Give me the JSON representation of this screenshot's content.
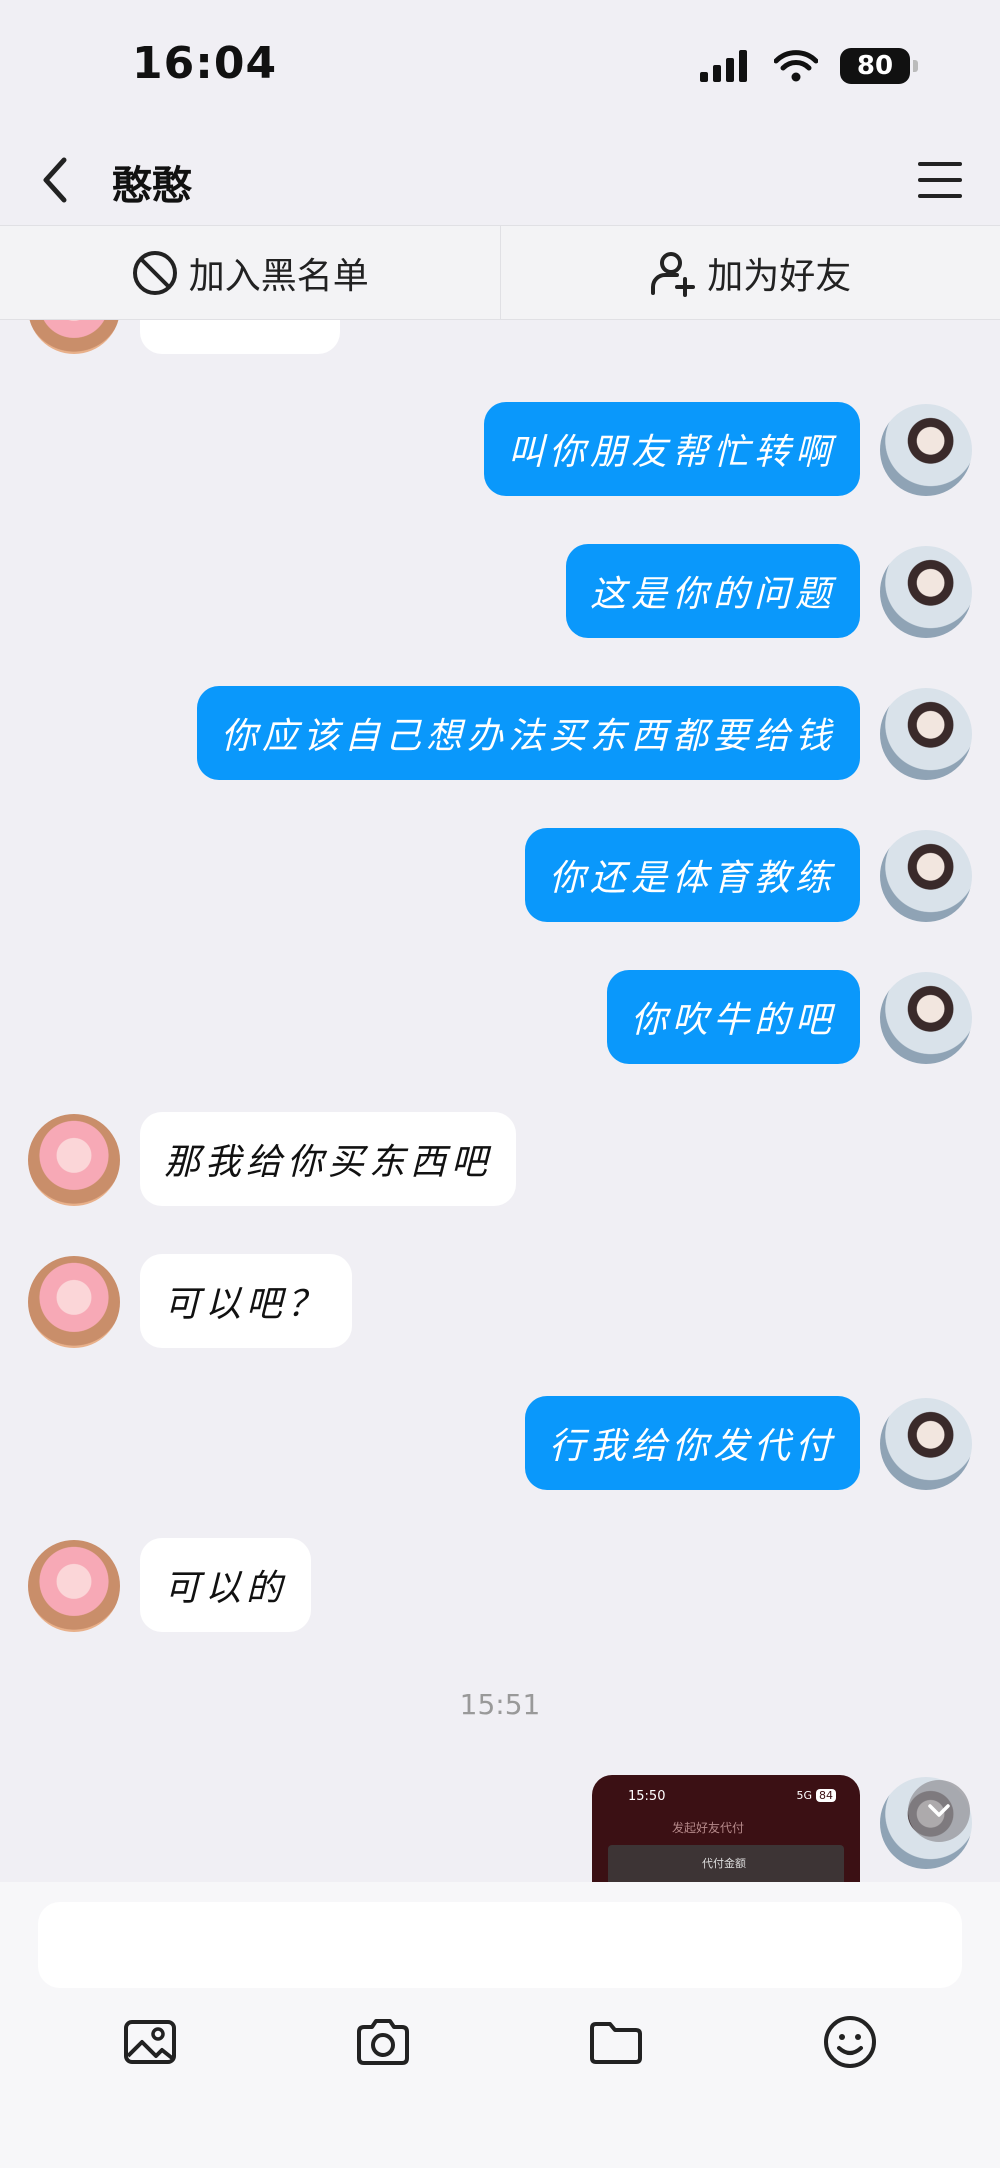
{
  "status": {
    "time": "16:04",
    "battery": "80"
  },
  "nav": {
    "title": "憨憨"
  },
  "actions": {
    "blacklist": "加入黑名单",
    "add_friend": "加为好友"
  },
  "messages": [
    {
      "from": "me",
      "text": "叫你朋友帮忙转啊"
    },
    {
      "from": "me",
      "text": "这是你的问题"
    },
    {
      "from": "me",
      "text": "你应该自己想办法买东西都要给钱"
    },
    {
      "from": "me",
      "text": "你还是体育教练"
    },
    {
      "from": "me",
      "text": "你吹牛的吧"
    },
    {
      "from": "them",
      "text": "那我给你买东西吧"
    },
    {
      "from": "them",
      "text": "可以吧？"
    },
    {
      "from": "me",
      "text": "行我给你发代付"
    },
    {
      "from": "them",
      "text": "可以的"
    }
  ],
  "time_separator": "15:51",
  "shared_screenshot": {
    "time": "15:50",
    "signal": "5G",
    "battery": "84",
    "title": "发起好友代付",
    "label": "代付金额"
  },
  "composer": {
    "placeholder": ""
  },
  "colors": {
    "my_bubble": "#0a98fb",
    "their_bubble": "#ffffff",
    "background": "#f0eff4"
  }
}
